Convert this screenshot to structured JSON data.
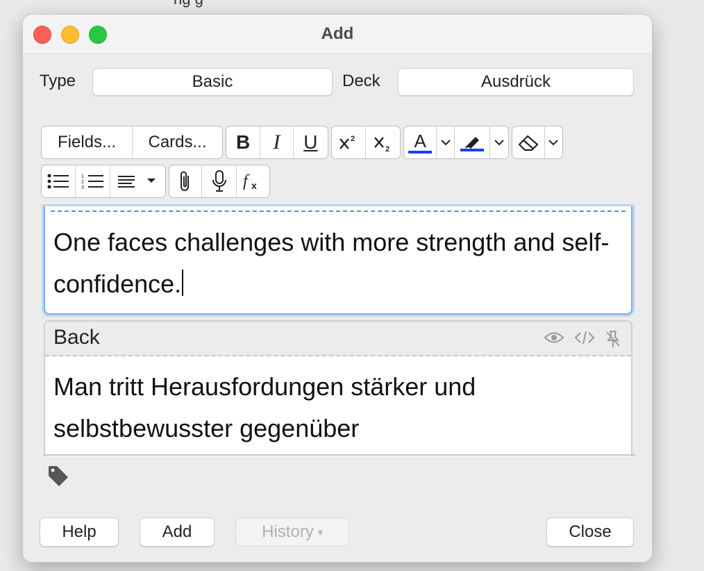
{
  "window": {
    "title": "Add"
  },
  "note_type": {
    "label": "Type",
    "value": "Basic"
  },
  "deck": {
    "label": "Deck",
    "value": "Ausdrück"
  },
  "toolbar": {
    "fields_label": "Fields...",
    "cards_label": "Cards...",
    "bold": "B",
    "italic": "I",
    "underline": "U",
    "text_color_letter": "A",
    "text_color": "#1a3cff",
    "highlight_color": "#1a3cff"
  },
  "fields": {
    "front": {
      "text": "One faces challenges with more strength and self-confidence."
    },
    "back": {
      "name": "Back",
      "text": "Man tritt Herausfordungen stärker und selbstbewusster gegenüber"
    }
  },
  "buttons": {
    "help": "Help",
    "add": "Add",
    "history": "History",
    "history_arrow": "▾",
    "close": "Close"
  },
  "icons": [
    "bullet-list-icon",
    "numbered-list-icon",
    "align-icon",
    "paperclip-icon",
    "microphone-icon",
    "formula-icon",
    "eraser-icon",
    "highlighter-icon",
    "eye-icon",
    "code-icon",
    "pin-icon",
    "tag-icon"
  ]
}
